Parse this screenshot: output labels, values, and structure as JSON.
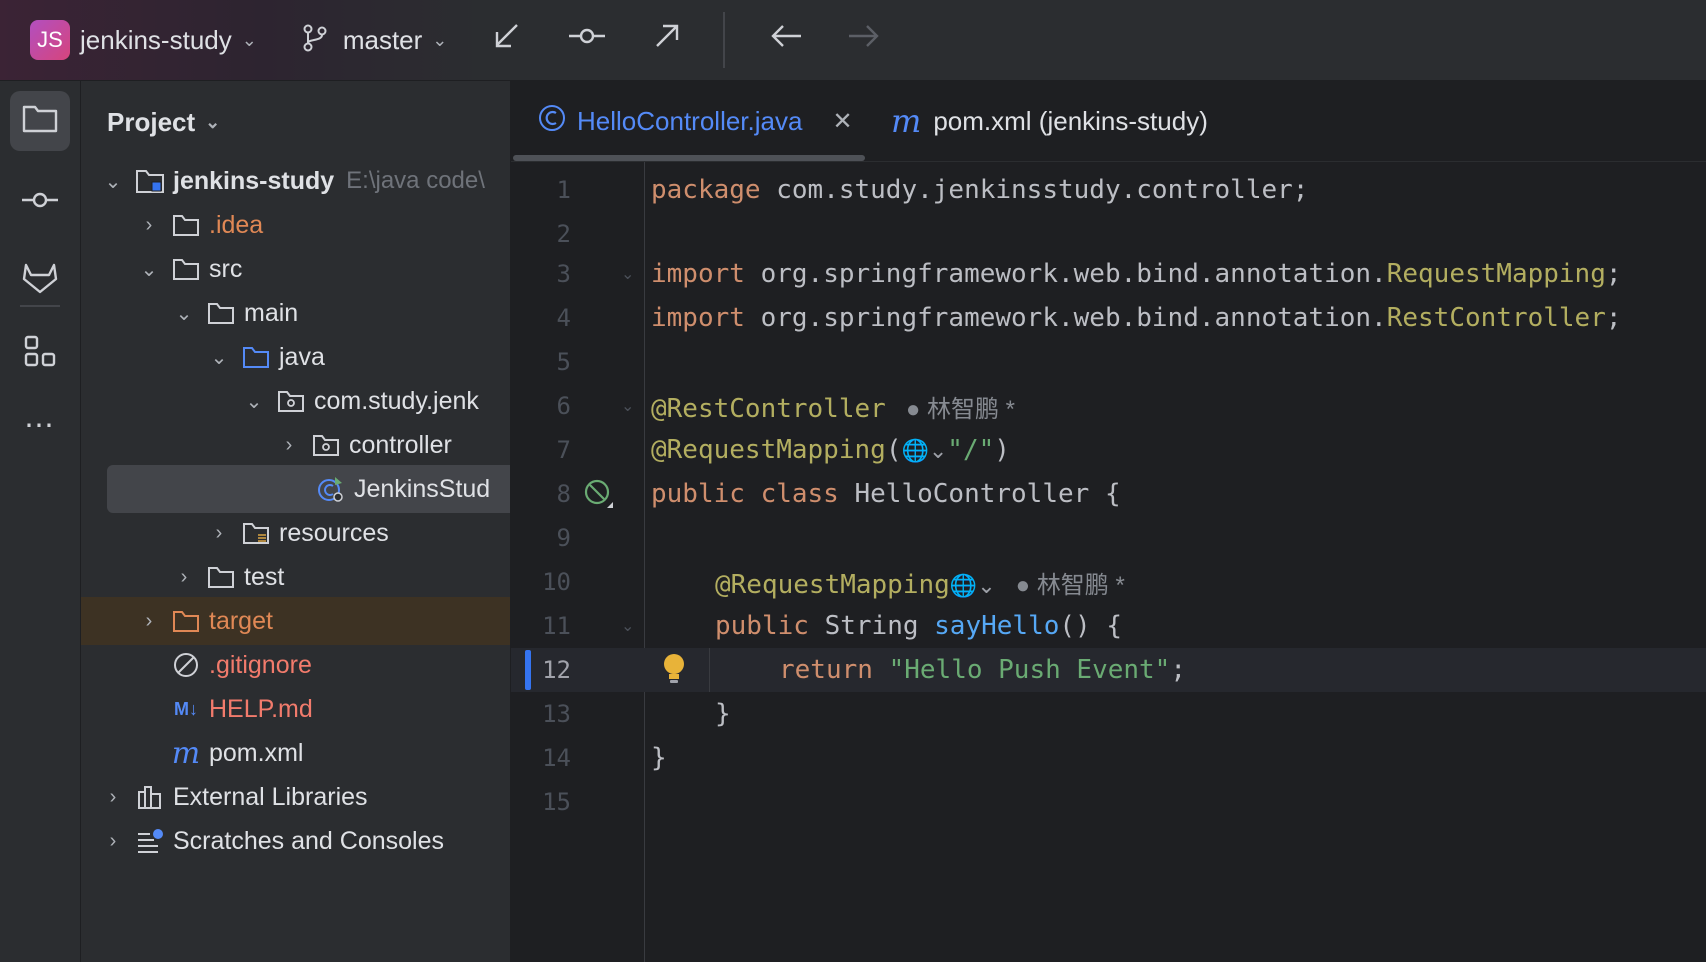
{
  "topbar": {
    "project_badge": "JS",
    "project_name": "jenkins-study",
    "branch": "master"
  },
  "panel": {
    "title": "Project",
    "tree": [
      {
        "label": "jenkins-study",
        "path": "E:\\java code\\"
      },
      {
        "label": ".idea"
      },
      {
        "label": "src"
      },
      {
        "label": "main"
      },
      {
        "label": "java"
      },
      {
        "label": "com.study.jenk"
      },
      {
        "label": "controller"
      },
      {
        "label": "JenkinsStud"
      },
      {
        "label": "resources"
      },
      {
        "label": "test"
      },
      {
        "label": "target"
      },
      {
        "label": ".gitignore"
      },
      {
        "label": "HELP.md"
      },
      {
        "label": "pom.xml"
      },
      {
        "label": "External Libraries"
      },
      {
        "label": "Scratches and Consoles"
      }
    ]
  },
  "editor": {
    "tabs": [
      {
        "label": "HelloController.java",
        "icon": "class-icon",
        "active": true
      },
      {
        "label": "pom.xml (jenkins-study)",
        "icon": "maven-icon",
        "active": false
      }
    ],
    "lines": [
      {
        "n": "1"
      },
      {
        "n": "2"
      },
      {
        "n": "3"
      },
      {
        "n": "4"
      },
      {
        "n": "5"
      },
      {
        "n": "6"
      },
      {
        "n": "7"
      },
      {
        "n": "8"
      },
      {
        "n": "9"
      },
      {
        "n": "10"
      },
      {
        "n": "11"
      },
      {
        "n": "12"
      },
      {
        "n": "13"
      },
      {
        "n": "14"
      },
      {
        "n": "15"
      }
    ],
    "code": {
      "l1_kw": "package",
      "l1_rest": " com.study.jenkinsstudy.controller;",
      "import_kw": "import",
      "l3_pkg": " org.springframework.web.bind.annotation.",
      "l3_cls": "RequestMapping",
      "semi": ";",
      "l4_pkg": " org.springframework.web.bind.annotation.",
      "l4_cls": "RestController",
      "l6_ann": "@RestController",
      "author": "林智鹏 *",
      "l7_ann": "@RequestMapping",
      "l7_open": "(",
      "l7_str": "\"/\"",
      "l7_close": ")",
      "l8_kw": "public class",
      "l8_rest": " HelloController {",
      "l10_ann": "@RequestMapping",
      "l11_kw": "public",
      "l11_type": " String ",
      "l11_fn": "sayHello",
      "l11_rest": "() {",
      "l12_kw": "return",
      "l12_str": "\"Hello Push Event\"",
      "l13": "}",
      "l14": "}"
    },
    "current_line": 12
  },
  "colors": {
    "keyword": "#cf8e6d",
    "annotation": "#b3ae60",
    "string": "#6aab73",
    "function": "#56a8f5",
    "accent": "#3574f0"
  }
}
